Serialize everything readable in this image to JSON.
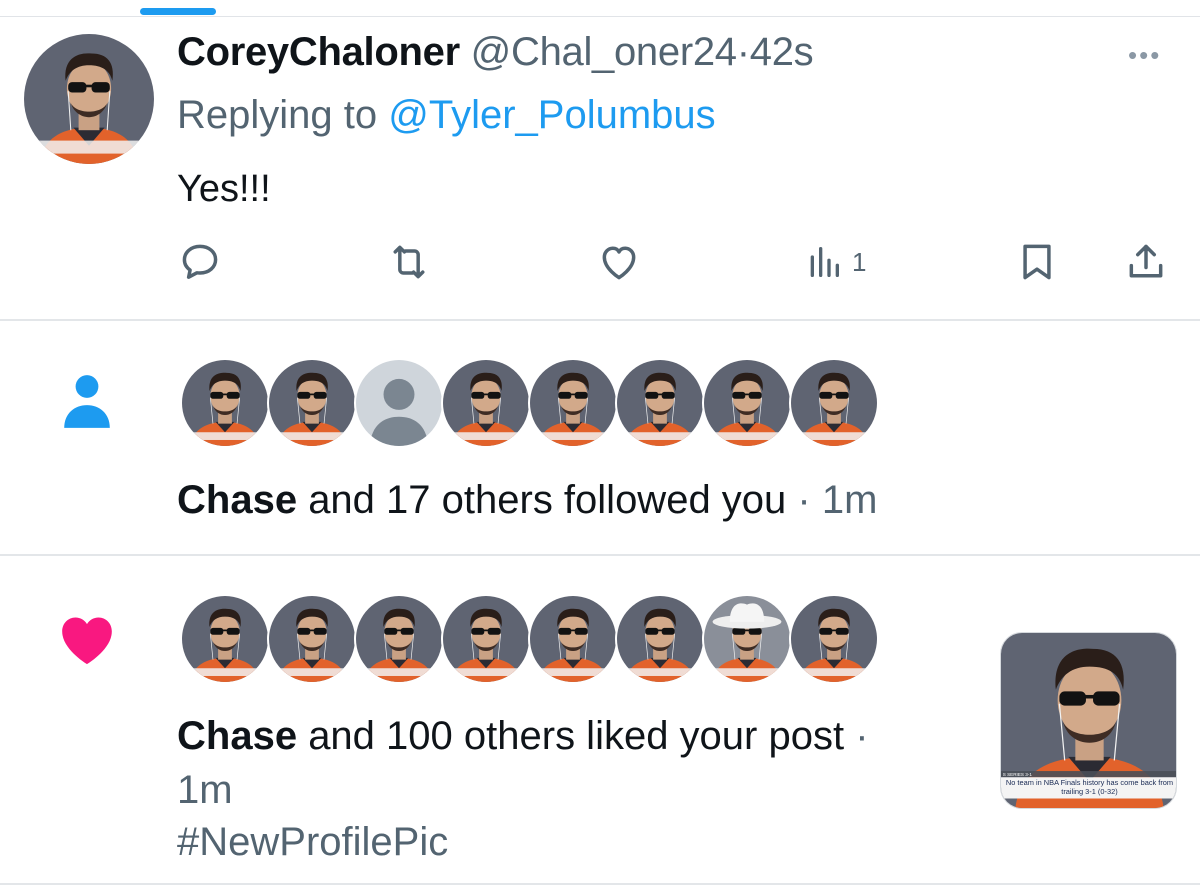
{
  "tweet": {
    "display_name": "CoreyChaloner",
    "handle": "@Chal_oner24",
    "separator": "·",
    "time": "42s",
    "replying_to_label": "Replying to",
    "replying_to_handle": "@Tyler_Polumbus",
    "text": "Yes!!!",
    "avatar_caption": "in NBA Finals history has come back from trailing 3-1 (0-32)",
    "actions": {
      "reply_icon": "comment-bubble-icon",
      "retweet_icon": "retweet-icon",
      "like_icon": "heart-outline-icon",
      "views_icon": "bar-chart-icon",
      "views_count": "1",
      "bookmark_icon": "bookmark-icon",
      "share_icon": "share-upload-icon"
    }
  },
  "follow_notification": {
    "icon": "person-icon",
    "icon_color": "#1d9bf0",
    "avatars": [
      "sunglasses",
      "sunglasses",
      "default",
      "sunglasses",
      "sunglasses",
      "sunglasses",
      "sunglasses",
      "sunglasses"
    ],
    "actor": "Chase",
    "text": "and 17 others followed you",
    "separator": "·",
    "time": "1m"
  },
  "like_notification": {
    "icon": "heart-filled-icon",
    "icon_color": "#f91880",
    "avatars": [
      "sunglasses",
      "sunglasses",
      "sunglasses",
      "sunglasses",
      "sunglasses",
      "sunglasses",
      "cowboy",
      "sunglasses"
    ],
    "actor": "Chase",
    "text": "and 100 others liked your post",
    "separator": "·",
    "time": "1m",
    "post_text": "#NewProfilePic",
    "thumbnail_caption_top": "S SERIES 3-1",
    "thumbnail_caption_main": "No team in NBA Finals history has come back from trailing 3-1 (0-32)"
  },
  "colors": {
    "accent": "#1d9bf0",
    "like": "#f91880",
    "secondary_text": "#536471",
    "jersey": "#e2622b",
    "backdrop": "#5f6472"
  }
}
